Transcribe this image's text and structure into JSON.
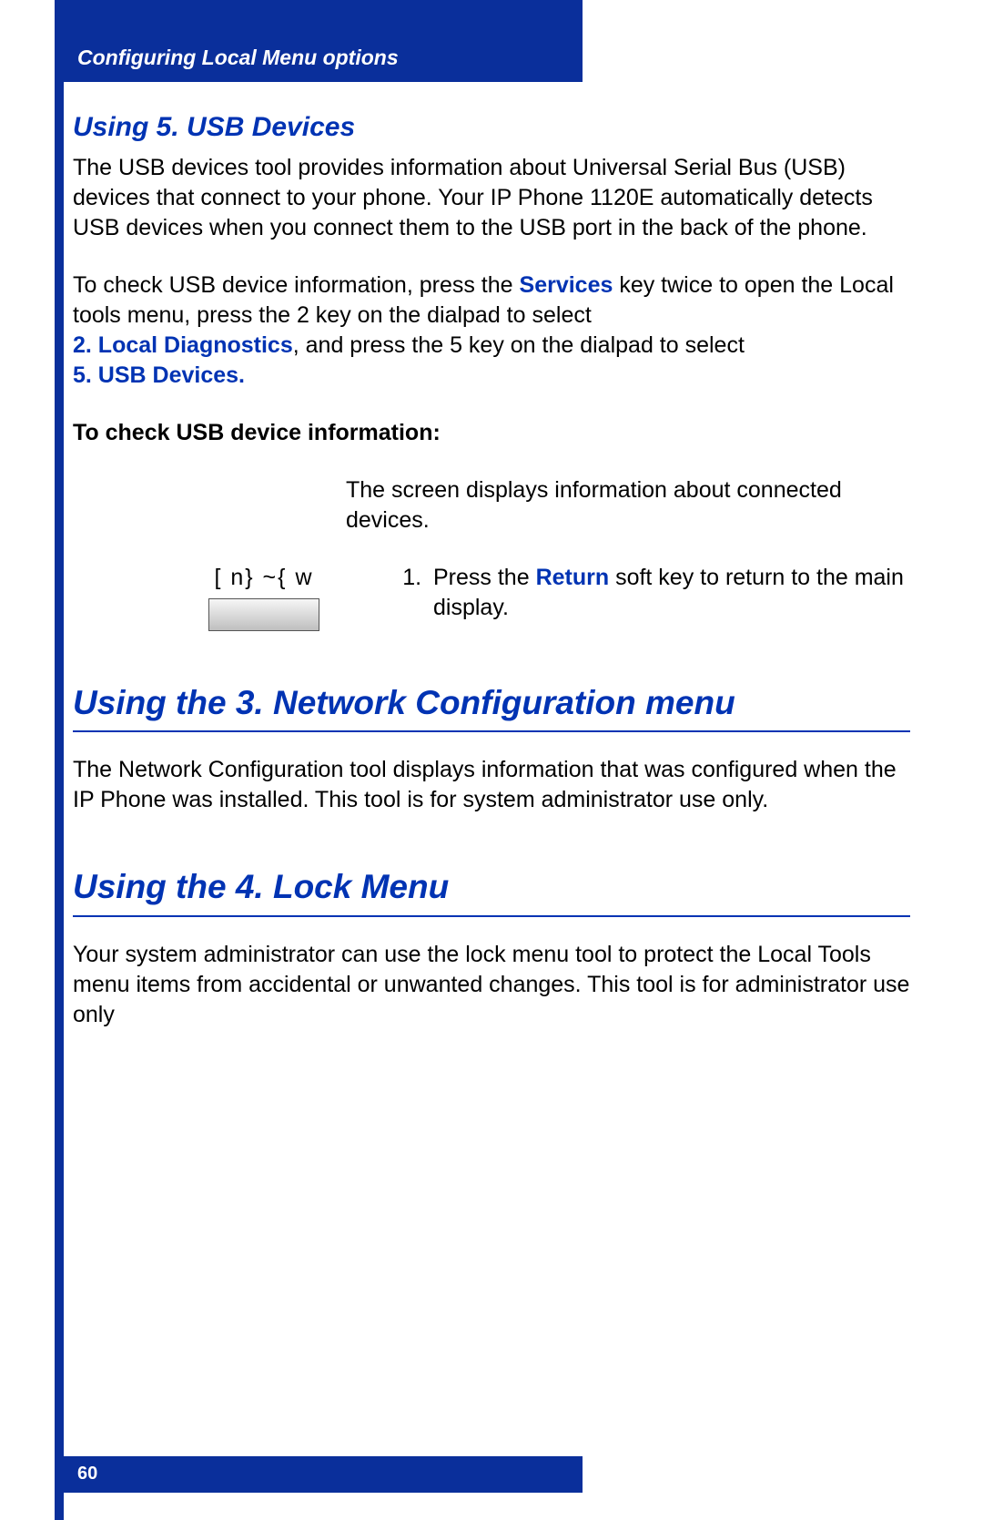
{
  "header": {
    "title": "Configuring Local Menu options"
  },
  "section1": {
    "heading": "Using 5. USB Devices",
    "para1": "The USB devices tool provides information about Universal Serial Bus (USB) devices that connect to your phone. Your IP Phone 1120E automatically detects USB devices when you connect them to the USB port in the back of the phone.",
    "para2_pre": "To check USB device information, press the ",
    "para2_services": "Services",
    "para2_mid1": " key twice to open the Local tools menu, press the 2 key on the dialpad to select ",
    "para2_diag": "2. Local Diagnostics",
    "para2_mid2": ", and press the 5 key on the dialpad to select ",
    "para2_usb": "5. USB Devices.",
    "subhead": "To check USB device information:",
    "screen_info": "The screen displays information about connected devices.",
    "key_caption": "[ n} ~{ w",
    "step_pre": "Press the ",
    "step_return": "Return",
    "step_post": " soft key to return to the main display."
  },
  "section2": {
    "heading": "Using the 3. Network Configuration menu",
    "para": "The Network Configuration tool displays information that was configured when the IP Phone was installed. This tool is for system administrator use only."
  },
  "section3": {
    "heading": "Using the 4. Lock Menu",
    "para": "Your system administrator can use the lock menu tool to protect the Local Tools menu items from accidental or unwanted changes. This tool is for administrator use only"
  },
  "footer": {
    "page_number": "60"
  }
}
